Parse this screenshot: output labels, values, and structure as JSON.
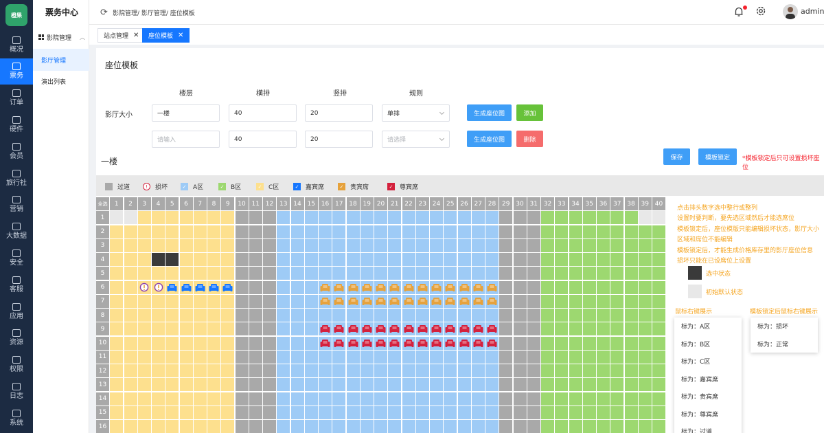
{
  "brand": {
    "logo_text": "橙果",
    "app_title": "票务中心"
  },
  "rail": [
    {
      "label": "概况",
      "icon": "chart-icon"
    },
    {
      "label": "票务",
      "icon": "layers-icon",
      "active": true
    },
    {
      "label": "订单",
      "icon": "list-icon"
    },
    {
      "label": "硬件",
      "icon": "server-icon"
    },
    {
      "label": "会员",
      "icon": "diamond-icon"
    },
    {
      "label": "旅行社",
      "icon": "grid-icon"
    },
    {
      "label": "营销",
      "icon": "board-icon"
    },
    {
      "label": "大数据",
      "icon": "calendar-icon"
    },
    {
      "label": "安全",
      "icon": "shield-icon"
    },
    {
      "label": "客服",
      "icon": "headset-icon"
    },
    {
      "label": "应用",
      "icon": "app-icon"
    },
    {
      "label": "资源",
      "icon": "folder-icon"
    },
    {
      "label": "权限",
      "icon": "lock-icon"
    },
    {
      "label": "日志",
      "icon": "log-icon"
    },
    {
      "label": "系统",
      "icon": "gear-icon"
    }
  ],
  "subnav": {
    "group": "影院管理",
    "items": [
      {
        "label": "影厅管理",
        "active": true
      },
      {
        "label": "演出列表",
        "active": false
      }
    ]
  },
  "header": {
    "breadcrumb": "影院管理/ 影厅管理/ 座位模板",
    "user": "admin"
  },
  "tabs": [
    {
      "label": "站点管理",
      "active": false
    },
    {
      "label": "座位模板",
      "active": true
    }
  ],
  "form": {
    "title": "座位模板",
    "hall_size_label": "影厅大小",
    "columns": [
      "楼层",
      "横排",
      "竖排",
      "规则"
    ],
    "rows": [
      {
        "floor": "一楼",
        "floor_placeholder": "",
        "cols": "40",
        "rows": "20",
        "rule": "单排",
        "rule_placeholder": "",
        "gen_label": "生成座位图",
        "action_label": "添加",
        "action": "add"
      },
      {
        "floor": "",
        "floor_placeholder": "请输入",
        "cols": "40",
        "rows": "20",
        "rule": "",
        "rule_placeholder": "请选择",
        "gen_label": "生成座位图",
        "action_label": "删除",
        "action": "delete"
      }
    ]
  },
  "floor": {
    "title": "一楼",
    "save_label": "保存",
    "lock_label": "模板锁定",
    "lock_note": "*模板锁定后只可设置损坏座位"
  },
  "legend": [
    {
      "label": "过道",
      "color": "#a9a9a9",
      "glyph": ""
    },
    {
      "label": "损坏",
      "color": "#ffffff",
      "glyph": "!"
    },
    {
      "label": "A区",
      "color": "#9ecbf6",
      "glyph": "✓"
    },
    {
      "label": "B区",
      "color": "#9dd870",
      "glyph": "✓"
    },
    {
      "label": "C区",
      "color": "#fde08e",
      "glyph": "✓"
    },
    {
      "label": "嘉宾席",
      "color": "#1677ff",
      "glyph": "✓"
    },
    {
      "label": "贵宾席",
      "color": "#e6a23c",
      "glyph": "✓"
    },
    {
      "label": "尊宾席",
      "color": "#d4213d",
      "glyph": "✓"
    }
  ],
  "seatmap": {
    "corner_label": "全选",
    "col_count": 40,
    "visible_rows": 16,
    "zones": [
      {
        "name": "C区",
        "from": 1,
        "to": 9,
        "color": "#fde08e"
      },
      {
        "name": "过道",
        "from": 10,
        "to": 12,
        "color": "#a9a9a9"
      },
      {
        "name": "A区",
        "from": 13,
        "to": 28,
        "color": "#9ecbf6"
      },
      {
        "name": "过道",
        "from": 29,
        "to": 31,
        "color": "#a9a9a9"
      },
      {
        "name": "B区",
        "from": 32,
        "to": 40,
        "color": "#9dd870"
      }
    ],
    "blank_cells": [
      [
        1,
        1
      ],
      [
        1,
        2
      ],
      [
        1,
        39
      ],
      [
        1,
        40
      ]
    ],
    "selected_cells": [
      [
        4,
        4
      ],
      [
        4,
        5
      ]
    ],
    "special": [
      {
        "type": "damaged",
        "row": 6,
        "cols": [
          3,
          4
        ]
      },
      {
        "type": "guest",
        "row": 6,
        "cols": [
          5,
          6,
          7,
          8,
          9
        ]
      },
      {
        "type": "vip",
        "row": 6,
        "cols": [
          16,
          17,
          18,
          19,
          20,
          21,
          22,
          23,
          24,
          25,
          26,
          27,
          28
        ]
      },
      {
        "type": "vip",
        "row": 7,
        "cols": [
          16,
          17,
          18,
          19,
          20,
          21,
          22,
          23,
          24,
          25,
          26,
          27,
          28
        ]
      },
      {
        "type": "svip",
        "row": 9,
        "cols": [
          16,
          17,
          18,
          19,
          20,
          21,
          22,
          23,
          24,
          25,
          26,
          27,
          28
        ]
      },
      {
        "type": "svip",
        "row": 10,
        "cols": [
          16,
          17,
          18,
          19,
          20,
          21,
          22,
          23,
          24,
          25,
          26,
          27,
          28
        ]
      }
    ],
    "seat_colors": {
      "guest": "#1677ff",
      "vip": "#e6a23c",
      "svip": "#d4213d",
      "damaged": "#8e44ad"
    },
    "selected_color": "#3a3a3a",
    "blank_color": "#e8e8e8"
  },
  "notes": [
    "点击排头数字选中整行或整列",
    "设置时要判断，要先选区域然后才能选席位",
    "模板锁定后，座位模版只能编辑损坏状态，影厅大小区域和席位不能编辑",
    "模板锁定后，才能生成价格库存里的影厅座位信息",
    "损坏只能在已设席位上设置"
  ],
  "states": [
    {
      "label": "选中状态",
      "color": "#3a3a3a"
    },
    {
      "label": "初始默认状态",
      "color": "#e8e8e8"
    }
  ],
  "context_menus": {
    "normal": {
      "title": "鼠标右键展示",
      "items": [
        "标为：A区",
        "标为：B区",
        "标为：C区",
        "标为：嘉宾席",
        "标为：贵宾席",
        "标为：尊宾席",
        "标为：过道"
      ]
    },
    "locked": {
      "title": "模板锁定后鼠标右键展示",
      "items": [
        "标为：损坏",
        "标为：正常"
      ]
    }
  }
}
